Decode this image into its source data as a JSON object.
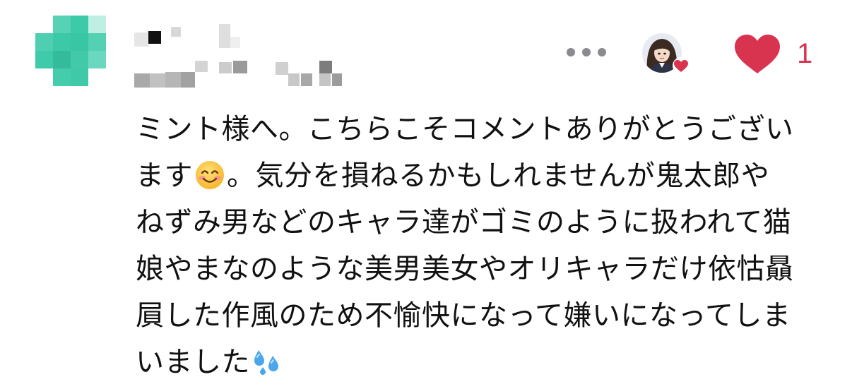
{
  "comment": {
    "avatar": {
      "icon": "avatar-pixelated",
      "color": "#4fcfae"
    },
    "author": {
      "censored": true
    },
    "actions": {
      "more_icon": "ellipsis-icon",
      "like_icon": "heart-icon",
      "like_color": "#d9344f",
      "like_count": "1"
    },
    "body_lines": [
      "ミント様へ。こちらこそコメントありがとうござい",
      "ます",
      "。気分を損ねるかもしれませんが鬼太郎や",
      "ねずみ男などのキャラ達がゴミのように扱われて猫",
      "娘やまなのような美男美女やオリキャラだけ依怙贔",
      "屓した作風のため不愉快になって嫌いになってしま",
      "いました"
    ],
    "emojis": [
      "smiling-face-icon",
      "sweat-droplets-icon"
    ]
  }
}
